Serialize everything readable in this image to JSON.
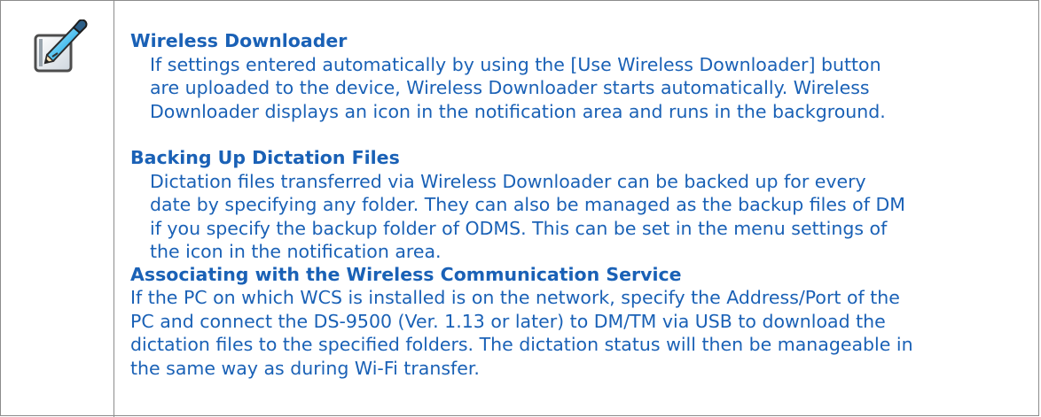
{
  "icon": {
    "name": "note-pencil-icon"
  },
  "sections": [
    {
      "title": "Wireless Downloader",
      "lines": [
        "If settings entered automatically by using the [Use Wireless Downloader] button",
        "are uploaded to the device, Wireless Downloader starts automatically. Wireless",
        "Downloader displays an icon in the notification area and runs in the background."
      ]
    },
    {
      "title": "Backing Up Dictation Files",
      "lines": [
        "Dictation files transferred via Wireless Downloader can be backed up for every",
        "date by specifying any folder. They can also be managed as the backup files of DM",
        "if you specify the backup folder of ODMS. This can be set in the menu settings of",
        "the icon in the notification area."
      ]
    },
    {
      "title": "Associating with the Wireless Communication Service",
      "lines": [
        "If the PC on which WCS is installed is on the network, specify the Address/Port of the",
        "PC and connect the DS-9500 (Ver. 1.13 or later) to DM/TM via USB to download the",
        "dictation files to the specified folders. The dictation status will then be manageable in",
        "the same way as during Wi-Fi transfer."
      ]
    }
  ],
  "colors": {
    "text": "#1a61b6",
    "border": "#8c8c8c"
  }
}
